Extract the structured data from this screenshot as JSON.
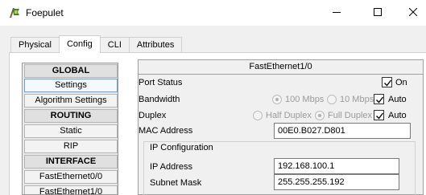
{
  "window": {
    "title": "Foepulet",
    "app_icon": "packet-tracer-icon",
    "controls": [
      "minimize-icon",
      "maximize-icon",
      "close-icon"
    ]
  },
  "tabs": [
    {
      "label": "Physical",
      "active": false
    },
    {
      "label": "Config",
      "active": true
    },
    {
      "label": "CLI",
      "active": false
    },
    {
      "label": "Attributes",
      "active": false
    }
  ],
  "nav": {
    "global": "GLOBAL",
    "settings": "Settings",
    "algorithm_settings": "Algorithm Settings",
    "routing": "ROUTING",
    "static": "Static",
    "rip": "RIP",
    "interface": "INTERFACE",
    "fe00": "FastEthernet0/0",
    "fe10": "FastEthernet1/0"
  },
  "panel": {
    "header": "FastEthernet1/0",
    "port_status": {
      "label": "Port Status",
      "on_label": "On",
      "on": true
    },
    "bandwidth": {
      "label": "Bandwidth",
      "opt100": "100 Mbps",
      "opt10": "10 Mbps",
      "auto_label": "Auto",
      "auto": true,
      "selected": "100 Mbps"
    },
    "duplex": {
      "label": "Duplex",
      "half": "Half Duplex",
      "full": "Full Duplex",
      "auto_label": "Auto",
      "auto": true,
      "selected": "Full Duplex"
    },
    "mac": {
      "label": "MAC Address",
      "value": "00E0.B027.D801"
    },
    "ip_config": {
      "title": "IP Configuration",
      "ip_label": "IP Address",
      "ip_value": "192.168.100.1",
      "mask_label": "Subnet Mask",
      "mask_value": "255.255.255.192"
    }
  },
  "colors": {
    "selected_border": "#6aa0e0",
    "window_bg": "#f0f0f0"
  }
}
